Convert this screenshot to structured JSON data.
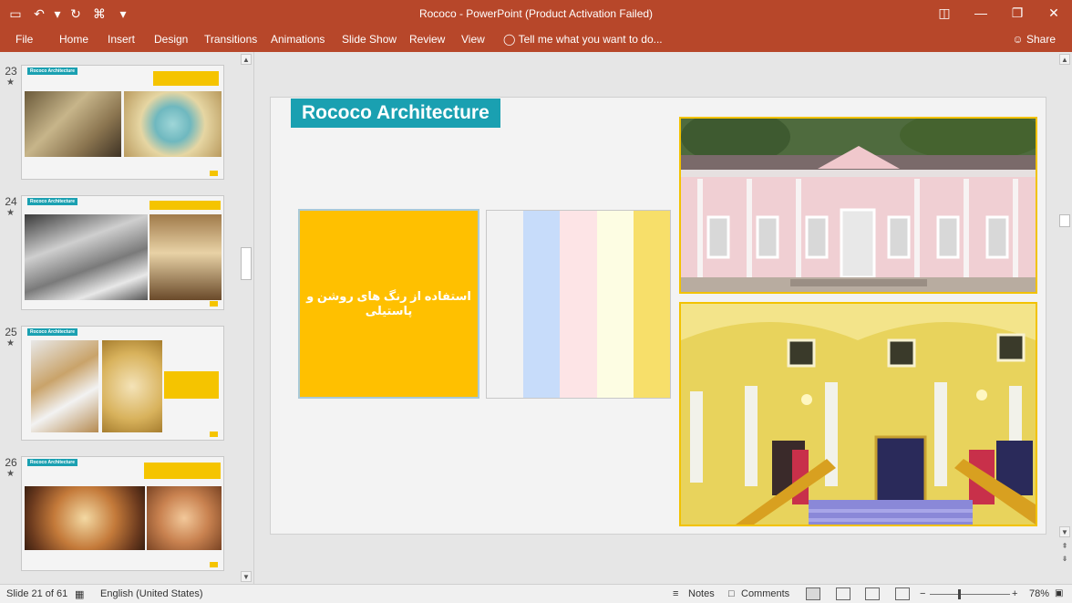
{
  "window": {
    "title": "Rococo - PowerPoint (Product Activation Failed)",
    "qat_icons": [
      "save-icon",
      "undo-icon",
      "dropdown-icon",
      "redo-icon",
      "presenter-icon",
      "customize-icon"
    ],
    "qat_glyphs": [
      "▭",
      "↶",
      "▾",
      "↻",
      "⌘",
      "▾"
    ],
    "win_glyphs": [
      "◫",
      "—",
      "❐",
      "✕"
    ]
  },
  "ribbon": {
    "tabs": [
      "File",
      "Home",
      "Insert",
      "Design",
      "Transitions",
      "Animations",
      "Slide Show",
      "Review",
      "View"
    ],
    "tell_me": "Tell me what you want to do...",
    "share": "Share"
  },
  "thumbnails": [
    {
      "number": "23",
      "title": "Rococo Architecture"
    },
    {
      "number": "24",
      "title": "Rococo Architecture"
    },
    {
      "number": "25",
      "title": "Rococo Architecture"
    },
    {
      "number": "26",
      "title": "Rococo Architecture"
    }
  ],
  "slide": {
    "title": "Rococo Architecture",
    "box_text": "استفاده از رنگ های روشن و پاستیلی",
    "palette_colors": [
      "#f2f2f2",
      "#c7dcfa",
      "#fde4e6",
      "#fdfde3",
      "#f7df6a"
    ],
    "accent_color": "#1aa0b1",
    "yellow_color": "#ffc000"
  },
  "status": {
    "slide_info": "Slide 21 of 61",
    "language": "English (United States)",
    "notes": "Notes",
    "comments": "Comments",
    "zoom": "78%"
  }
}
